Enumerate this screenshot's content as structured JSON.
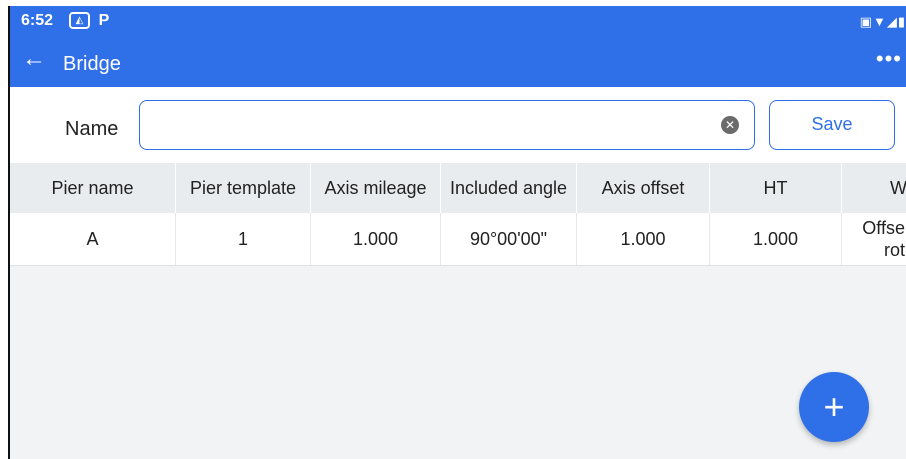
{
  "status_bar": {
    "time": "6:52",
    "icons": [
      "gallery-icon",
      "p-icon",
      "cast-icon",
      "wifi-icon",
      "signal-icon",
      "battery-icon"
    ]
  },
  "app_bar": {
    "back_icon": "arrow-left-icon",
    "title": "Bridge",
    "more_icon": "more-horizontal-icon",
    "color": "#2f6fe8"
  },
  "form": {
    "name_label": "Name",
    "name_value": "",
    "save_label": "Save"
  },
  "table": {
    "headers": [
      "Pier name",
      "Pier template",
      "Axis mileage",
      "Included angle",
      "Axis offset",
      "HT",
      "W"
    ],
    "rows": [
      [
        "A",
        "1",
        "1.000",
        "90°00'00\"",
        "1.000",
        "1.000",
        "Offse",
        "rot"
      ]
    ]
  },
  "fab": {
    "label": "+",
    "icon": "plus-icon"
  }
}
